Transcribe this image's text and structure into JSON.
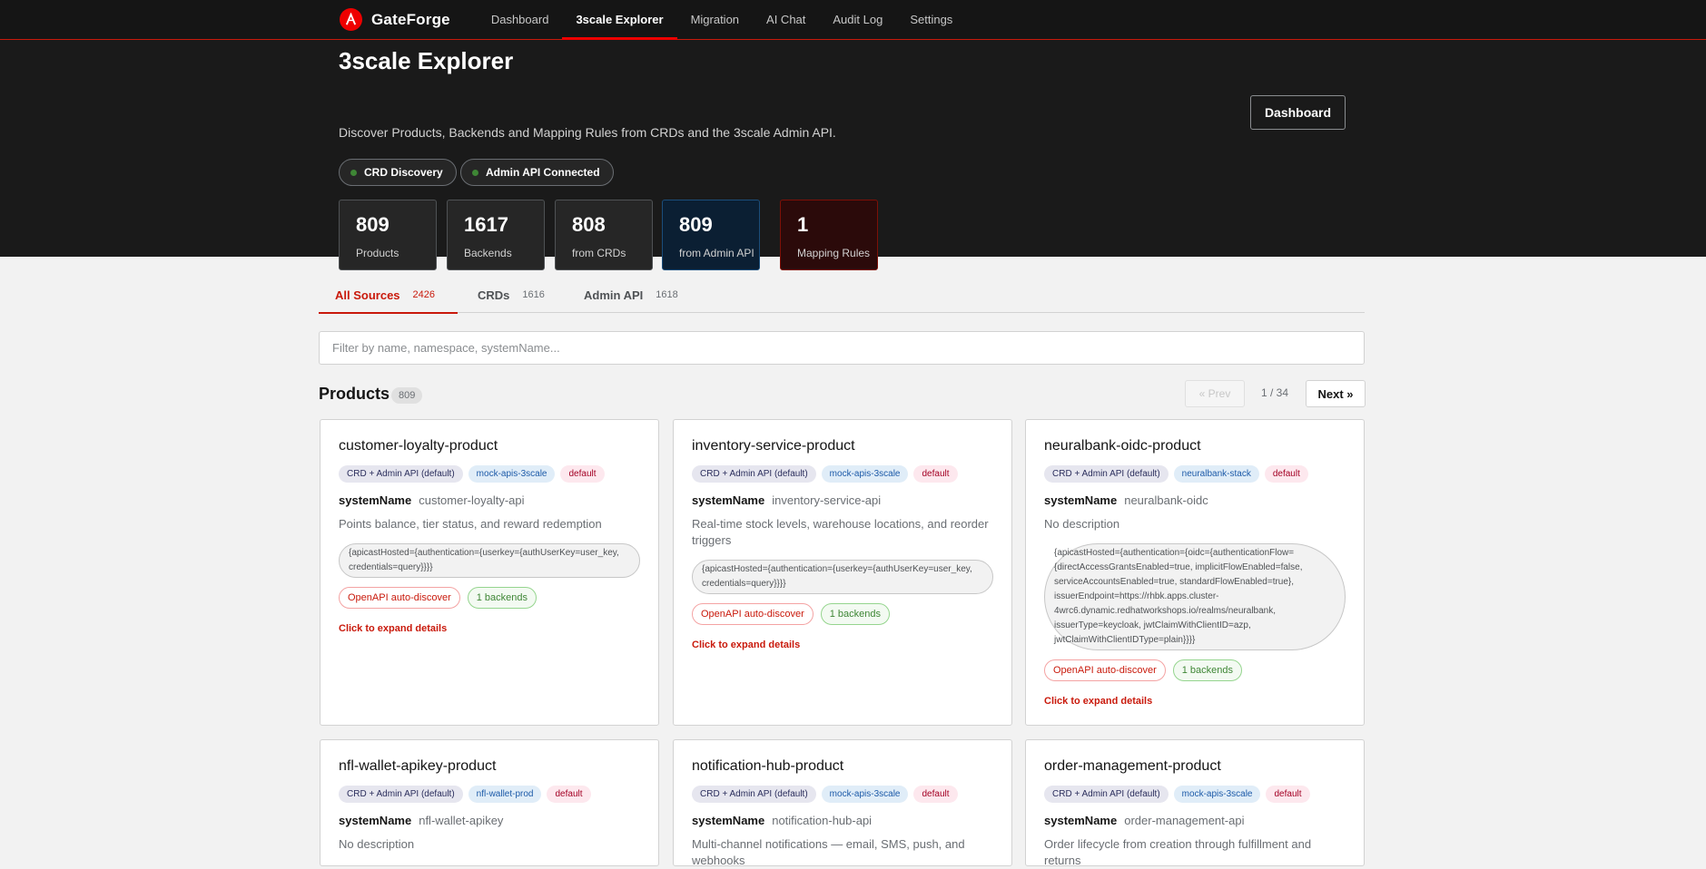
{
  "nav": {
    "brand": "GateForge",
    "links": [
      {
        "label": "Dashboard"
      },
      {
        "label": "3scale Explorer"
      },
      {
        "label": "Migration"
      },
      {
        "label": "AI Chat"
      },
      {
        "label": "Audit Log"
      },
      {
        "label": "Settings"
      }
    ],
    "active_index": 1
  },
  "hero": {
    "title": "3scale Explorer",
    "subtitle": "Discover Products, Backends and Mapping Rules from CRDs and the 3scale Admin API.",
    "dashboard_button": "Dashboard",
    "status_pills": [
      {
        "label": "CRD Discovery",
        "color": "#3e8635"
      },
      {
        "label": "Admin API Connected",
        "color": "#3e8635"
      }
    ],
    "stats": [
      {
        "value": "809",
        "label": "Products"
      },
      {
        "value": "1617",
        "label": "Backends"
      },
      {
        "value": "808",
        "label": "from CRDs"
      },
      {
        "value": "809",
        "label": "from Admin API"
      },
      {
        "value": "1",
        "label": "Mapping Rules"
      }
    ]
  },
  "tabs": [
    {
      "label": "All Sources",
      "count": "2426"
    },
    {
      "label": "CRDs",
      "count": "1616"
    },
    {
      "label": "Admin API",
      "count": "1618"
    }
  ],
  "filter": {
    "placeholder": "Filter by name, namespace, systemName...",
    "value": ""
  },
  "products": {
    "title": "Products",
    "count": "809",
    "pager": {
      "prev": "« Prev",
      "page": "1 / 34",
      "next": "Next »"
    },
    "cards": [
      {
        "name": "customer-loyalty-product",
        "source": "CRD + Admin API (default)",
        "namespace": "mock-apis-3scale",
        "project": "default",
        "system_label": "systemName",
        "system_name": "customer-loyalty-api",
        "description": "Points balance, tier status, and reward redemption",
        "auth": "{apicastHosted={authentication={userkey={authUserKey=user_key, credentials=query}}}}",
        "openapi": "OpenAPI auto-discover",
        "backends": "1 backends",
        "expand": "Click to expand details"
      },
      {
        "name": "inventory-service-product",
        "source": "CRD + Admin API (default)",
        "namespace": "mock-apis-3scale",
        "project": "default",
        "system_label": "systemName",
        "system_name": "inventory-service-api",
        "description": "Real-time stock levels, warehouse locations, and reorder triggers",
        "auth": "{apicastHosted={authentication={userkey={authUserKey=user_key, credentials=query}}}}",
        "openapi": "OpenAPI auto-discover",
        "backends": "1 backends",
        "expand": "Click to expand details"
      },
      {
        "name": "neuralbank-oidc-product",
        "source": "CRD + Admin API (default)",
        "namespace": "neuralbank-stack",
        "project": "default",
        "system_label": "systemName",
        "system_name": "neuralbank-oidc",
        "description": "No description",
        "auth": "{apicastHosted={authentication={oidc={authenticationFlow={directAccessGrantsEnabled=true, implicitFlowEnabled=false, serviceAccountsEnabled=true, standardFlowEnabled=true}, issuerEndpoint=https://rhbk.apps.cluster-4wrc6.dynamic.redhatworkshops.io/realms/neuralbank, issuerType=keycloak, jwtClaimWithClientID=azp, jwtClaimWithClientIDType=plain}}}}",
        "openapi": "OpenAPI auto-discover",
        "backends": "1 backends",
        "expand": "Click to expand details"
      },
      {
        "name": "nfl-wallet-apikey-product",
        "source": "CRD + Admin API (default)",
        "namespace": "nfl-wallet-prod",
        "project": "default",
        "system_label": "systemName",
        "system_name": "nfl-wallet-apikey",
        "description": "No description"
      },
      {
        "name": "notification-hub-product",
        "source": "CRD + Admin API (default)",
        "namespace": "mock-apis-3scale",
        "project": "default",
        "system_label": "systemName",
        "system_name": "notification-hub-api",
        "description": "Multi-channel notifications — email, SMS, push, and webhooks"
      },
      {
        "name": "order-management-product",
        "source": "CRD + Admin API (default)",
        "namespace": "mock-apis-3scale",
        "project": "default",
        "system_label": "systemName",
        "system_name": "order-management-api",
        "description": "Order lifecycle from creation through fulfillment and returns"
      }
    ]
  }
}
